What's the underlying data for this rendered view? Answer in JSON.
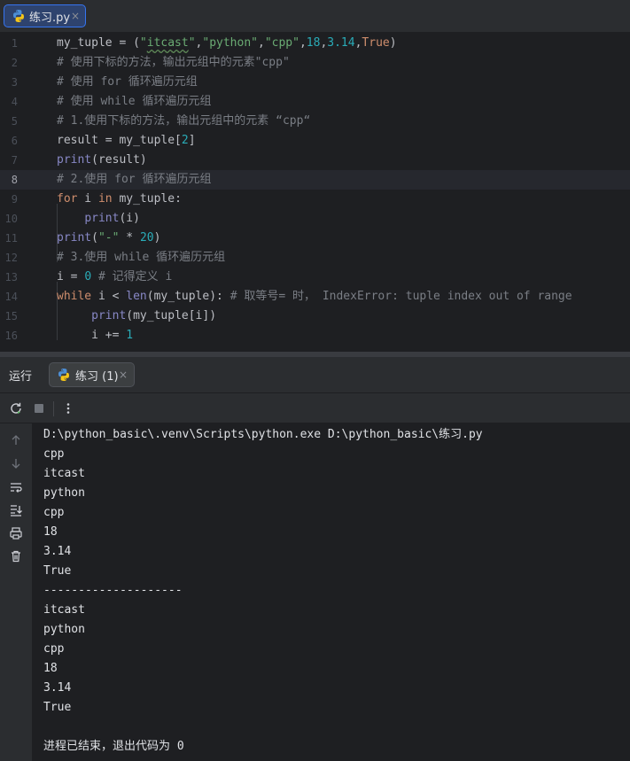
{
  "editor_tab": {
    "label": "练习.py",
    "icon": "python-file-icon",
    "close": "×"
  },
  "editor": {
    "current_line": 8,
    "line_numbers": [
      "1",
      "2",
      "3",
      "4",
      "5",
      "6",
      "7",
      "8",
      "9",
      "10",
      "11",
      "12",
      "13",
      "14",
      "15",
      "16"
    ],
    "lines": [
      {
        "tokens": [
          [
            "t",
            "my_tuple = ("
          ],
          [
            "str",
            "\""
          ],
          [
            "str typo",
            "itcast"
          ],
          [
            "str",
            "\""
          ],
          [
            "t",
            ","
          ],
          [
            "str",
            "\"python\""
          ],
          [
            "t",
            ","
          ],
          [
            "str",
            "\"cpp\""
          ],
          [
            "t",
            ","
          ],
          [
            "num",
            "18"
          ],
          [
            "t",
            ","
          ],
          [
            "num",
            "3.14"
          ],
          [
            "t",
            ","
          ],
          [
            "kw",
            "True"
          ],
          [
            "t",
            ")"
          ]
        ]
      },
      {
        "tokens": [
          [
            "cm",
            "# 使用下标的方法，输出元组中的元素\"cpp\""
          ]
        ]
      },
      {
        "tokens": [
          [
            "cm",
            "# 使用 for 循环遍历元组"
          ]
        ]
      },
      {
        "tokens": [
          [
            "cm",
            "# 使用 while 循环遍历元组"
          ]
        ]
      },
      {
        "tokens": [
          [
            "cm",
            "# 1.使用下标的方法，输出元组中的元素 “cpp“"
          ]
        ]
      },
      {
        "tokens": [
          [
            "t",
            "result = my_tuple["
          ],
          [
            "num",
            "2"
          ],
          [
            "t",
            "]"
          ]
        ]
      },
      {
        "tokens": [
          [
            "bi",
            "print"
          ],
          [
            "t",
            "(result)"
          ]
        ]
      },
      {
        "tokens": [
          [
            "cm",
            "# 2.使用 for 循环遍历元组"
          ]
        ]
      },
      {
        "tokens": [
          [
            "kw",
            "for"
          ],
          [
            "t",
            " i "
          ],
          [
            "kw",
            "in"
          ],
          [
            "t",
            " my_tuple:"
          ]
        ]
      },
      {
        "tokens": [
          [
            "t",
            "    "
          ],
          [
            "bi",
            "print"
          ],
          [
            "t",
            "(i)"
          ]
        ]
      },
      {
        "tokens": [
          [
            "bi",
            "print"
          ],
          [
            "t",
            "("
          ],
          [
            "str",
            "\"-\""
          ],
          [
            "t",
            " * "
          ],
          [
            "num",
            "20"
          ],
          [
            "t",
            ")"
          ]
        ]
      },
      {
        "tokens": [
          [
            "cm",
            "# 3.使用 while 循环遍历元组"
          ]
        ]
      },
      {
        "tokens": [
          [
            "t",
            "i = "
          ],
          [
            "num",
            "0"
          ],
          [
            "t",
            " "
          ],
          [
            "cm",
            "# 记得定义 i"
          ]
        ]
      },
      {
        "tokens": [
          [
            "kw",
            "while"
          ],
          [
            "t",
            " i < "
          ],
          [
            "bi",
            "len"
          ],
          [
            "t",
            "(my_tuple): "
          ],
          [
            "cm",
            "# 取等号= 时， IndexError: tuple index out of range"
          ]
        ]
      },
      {
        "tokens": [
          [
            "t",
            "     "
          ],
          [
            "bi",
            "print"
          ],
          [
            "t",
            "(my_tuple[i])"
          ]
        ]
      },
      {
        "tokens": [
          [
            "t",
            "     i += "
          ],
          [
            "num",
            "1"
          ]
        ]
      }
    ]
  },
  "run_panel": {
    "title": "运行",
    "tab_label": "练习 (1)",
    "tab_close": "×",
    "toolbar": {
      "rerun": "rerun-icon",
      "stop": "stop-icon",
      "more": "more-vertical-icon"
    },
    "side_tools": [
      "arrow-up-icon",
      "arrow-down-icon",
      "soft-wrap-icon",
      "scroll-to-end-icon",
      "print-icon",
      "trash-icon"
    ]
  },
  "console": {
    "lines": [
      "D:\\python_basic\\.venv\\Scripts\\python.exe D:\\python_basic\\练习.py",
      "cpp",
      "itcast",
      "python",
      "cpp",
      "18",
      "3.14",
      "True",
      "--------------------",
      "itcast",
      "python",
      "cpp",
      "18",
      "3.14",
      "True",
      "",
      "进程已结束，退出代码为 0"
    ]
  },
  "colors": {
    "accent": "#3574f0",
    "background": "#1e1f22",
    "panel": "#2b2d30"
  }
}
